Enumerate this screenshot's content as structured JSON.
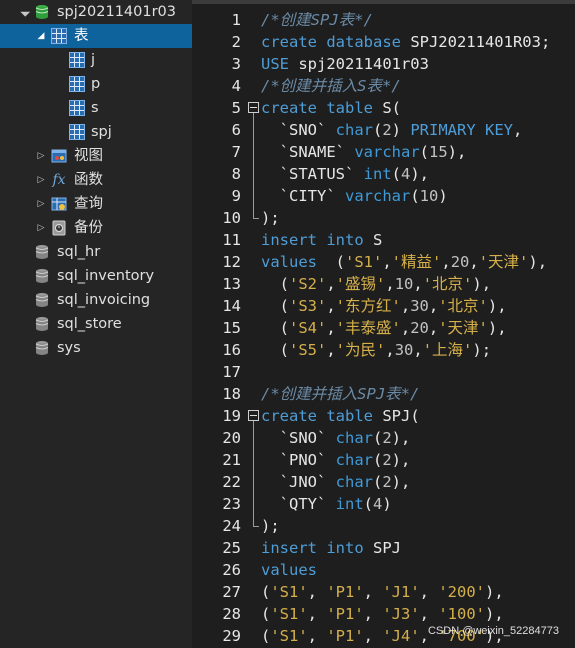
{
  "sidebar": {
    "database": {
      "label": "spj20211401r03",
      "expanded": true
    },
    "tables_node": {
      "label": "表"
    },
    "tables": [
      {
        "label": "j"
      },
      {
        "label": "p"
      },
      {
        "label": "s"
      },
      {
        "label": "spj"
      }
    ],
    "groups": [
      {
        "label": "视图",
        "icon": "view-icon"
      },
      {
        "label": "函数",
        "icon": "function-icon"
      },
      {
        "label": "查询",
        "icon": "query-icon"
      },
      {
        "label": "备份",
        "icon": "backup-icon"
      }
    ],
    "other_databases": [
      {
        "label": "sql_hr"
      },
      {
        "label": "sql_inventory"
      },
      {
        "label": "sql_invoicing"
      },
      {
        "label": "sql_store"
      },
      {
        "label": "sys"
      }
    ]
  },
  "editor": {
    "lines": [
      {
        "n": "1",
        "fold": "",
        "tokens": [
          [
            "comment",
            "/*创建SPJ表*/"
          ]
        ]
      },
      {
        "n": "2",
        "fold": "",
        "tokens": [
          [
            "kw",
            "create database "
          ],
          [
            "id",
            "SPJ20211401R03;"
          ]
        ]
      },
      {
        "n": "3",
        "fold": "",
        "tokens": [
          [
            "kw",
            "USE "
          ],
          [
            "id",
            "spj20211401r03"
          ]
        ]
      },
      {
        "n": "4",
        "fold": "",
        "tokens": [
          [
            "comment",
            "/*创建并插入S表*/"
          ]
        ]
      },
      {
        "n": "5",
        "fold": "start",
        "tokens": [
          [
            "kw",
            "create table "
          ],
          [
            "id",
            "S("
          ]
        ]
      },
      {
        "n": "6",
        "fold": "in",
        "tokens": [
          [
            "id",
            "  `SNO` "
          ],
          [
            "type",
            "char"
          ],
          [
            "id",
            "("
          ],
          [
            "num",
            "2"
          ],
          [
            "id",
            ") "
          ],
          [
            "kw",
            "PRIMARY KEY"
          ],
          [
            "id",
            ","
          ]
        ]
      },
      {
        "n": "7",
        "fold": "in",
        "tokens": [
          [
            "id",
            "  `SNAME` "
          ],
          [
            "type",
            "varchar"
          ],
          [
            "id",
            "("
          ],
          [
            "num",
            "15"
          ],
          [
            "id",
            "),"
          ]
        ]
      },
      {
        "n": "8",
        "fold": "in",
        "tokens": [
          [
            "id",
            "  `STATUS` "
          ],
          [
            "type",
            "int"
          ],
          [
            "id",
            "("
          ],
          [
            "num",
            "4"
          ],
          [
            "id",
            "),"
          ]
        ]
      },
      {
        "n": "9",
        "fold": "in",
        "tokens": [
          [
            "id",
            "  `CITY` "
          ],
          [
            "type",
            "varchar"
          ],
          [
            "id",
            "("
          ],
          [
            "num",
            "10"
          ],
          [
            "id",
            ")"
          ]
        ]
      },
      {
        "n": "10",
        "fold": "end",
        "tokens": [
          [
            "id",
            ");"
          ]
        ]
      },
      {
        "n": "11",
        "fold": "",
        "tokens": [
          [
            "kw",
            "insert into "
          ],
          [
            "id",
            "S"
          ]
        ]
      },
      {
        "n": "12",
        "fold": "",
        "tokens": [
          [
            "kw",
            "values  "
          ],
          [
            "id",
            "("
          ],
          [
            "str",
            "'S1'"
          ],
          [
            "id",
            ","
          ],
          [
            "str",
            "'精益'"
          ],
          [
            "id",
            ","
          ],
          [
            "num",
            "20"
          ],
          [
            "id",
            ","
          ],
          [
            "str",
            "'天津'"
          ],
          [
            "id",
            "),"
          ]
        ]
      },
      {
        "n": "13",
        "fold": "",
        "tokens": [
          [
            "id",
            "  ("
          ],
          [
            "str",
            "'S2'"
          ],
          [
            "id",
            ","
          ],
          [
            "str",
            "'盛锡'"
          ],
          [
            "id",
            ","
          ],
          [
            "num",
            "10"
          ],
          [
            "id",
            ","
          ],
          [
            "str",
            "'北京'"
          ],
          [
            "id",
            "),"
          ]
        ]
      },
      {
        "n": "14",
        "fold": "",
        "tokens": [
          [
            "id",
            "  ("
          ],
          [
            "str",
            "'S3'"
          ],
          [
            "id",
            ","
          ],
          [
            "str",
            "'东方红'"
          ],
          [
            "id",
            ","
          ],
          [
            "num",
            "30"
          ],
          [
            "id",
            ","
          ],
          [
            "str",
            "'北京'"
          ],
          [
            "id",
            "),"
          ]
        ]
      },
      {
        "n": "15",
        "fold": "",
        "tokens": [
          [
            "id",
            "  ("
          ],
          [
            "str",
            "'S4'"
          ],
          [
            "id",
            ","
          ],
          [
            "str",
            "'丰泰盛'"
          ],
          [
            "id",
            ","
          ],
          [
            "num",
            "20"
          ],
          [
            "id",
            ","
          ],
          [
            "str",
            "'天津'"
          ],
          [
            "id",
            "),"
          ]
        ]
      },
      {
        "n": "16",
        "fold": "",
        "tokens": [
          [
            "id",
            "  ("
          ],
          [
            "str",
            "'S5'"
          ],
          [
            "id",
            ","
          ],
          [
            "str",
            "'为民'"
          ],
          [
            "id",
            ","
          ],
          [
            "num",
            "30"
          ],
          [
            "id",
            ","
          ],
          [
            "str",
            "'上海'"
          ],
          [
            "id",
            ");"
          ]
        ]
      },
      {
        "n": "17",
        "fold": "",
        "tokens": []
      },
      {
        "n": "18",
        "fold": "",
        "tokens": [
          [
            "comment",
            "/*创建并插入SPJ表*/"
          ]
        ]
      },
      {
        "n": "19",
        "fold": "start",
        "tokens": [
          [
            "kw",
            "create table "
          ],
          [
            "id",
            "SPJ("
          ]
        ]
      },
      {
        "n": "20",
        "fold": "in",
        "tokens": [
          [
            "id",
            "  `SNO` "
          ],
          [
            "type",
            "char"
          ],
          [
            "id",
            "("
          ],
          [
            "num",
            "2"
          ],
          [
            "id",
            "),"
          ]
        ]
      },
      {
        "n": "21",
        "fold": "in",
        "tokens": [
          [
            "id",
            "  `PNO` "
          ],
          [
            "type",
            "char"
          ],
          [
            "id",
            "("
          ],
          [
            "num",
            "2"
          ],
          [
            "id",
            "),"
          ]
        ]
      },
      {
        "n": "22",
        "fold": "in",
        "tokens": [
          [
            "id",
            "  `JNO` "
          ],
          [
            "type",
            "char"
          ],
          [
            "id",
            "("
          ],
          [
            "num",
            "2"
          ],
          [
            "id",
            "),"
          ]
        ]
      },
      {
        "n": "23",
        "fold": "in",
        "tokens": [
          [
            "id",
            "  `QTY` "
          ],
          [
            "type",
            "int"
          ],
          [
            "id",
            "("
          ],
          [
            "num",
            "4"
          ],
          [
            "id",
            ")"
          ]
        ]
      },
      {
        "n": "24",
        "fold": "end",
        "tokens": [
          [
            "id",
            ");"
          ]
        ]
      },
      {
        "n": "25",
        "fold": "",
        "tokens": [
          [
            "kw",
            "insert into "
          ],
          [
            "id",
            "SPJ"
          ]
        ]
      },
      {
        "n": "26",
        "fold": "",
        "tokens": [
          [
            "kw",
            "values"
          ]
        ]
      },
      {
        "n": "27",
        "fold": "",
        "tokens": [
          [
            "id",
            "("
          ],
          [
            "str",
            "'S1'"
          ],
          [
            "id",
            ", "
          ],
          [
            "str",
            "'P1'"
          ],
          [
            "id",
            ", "
          ],
          [
            "str",
            "'J1'"
          ],
          [
            "id",
            ", "
          ],
          [
            "str",
            "'200'"
          ],
          [
            "id",
            "),"
          ]
        ]
      },
      {
        "n": "28",
        "fold": "",
        "tokens": [
          [
            "id",
            "("
          ],
          [
            "str",
            "'S1'"
          ],
          [
            "id",
            ", "
          ],
          [
            "str",
            "'P1'"
          ],
          [
            "id",
            ", "
          ],
          [
            "str",
            "'J3'"
          ],
          [
            "id",
            ", "
          ],
          [
            "str",
            "'100'"
          ],
          [
            "id",
            "),"
          ]
        ]
      },
      {
        "n": "29",
        "fold": "",
        "tokens": [
          [
            "id",
            "("
          ],
          [
            "str",
            "'S1'"
          ],
          [
            "id",
            ", "
          ],
          [
            "str",
            "'P1'"
          ],
          [
            "id",
            ", "
          ],
          [
            "str",
            "'J4'"
          ],
          [
            "id",
            ", "
          ],
          [
            "str",
            "'700'"
          ],
          [
            "id",
            "),"
          ]
        ]
      }
    ]
  },
  "watermark": "CSDN @weixin_52284773",
  "colors": {
    "selected_row": "#0e639c",
    "sidebar_bg": "#252526",
    "editor_bg": "#1e1e1e",
    "comment": "#6a8aa6",
    "keyword": "#4e9dd6",
    "string": "#d5b04a"
  }
}
